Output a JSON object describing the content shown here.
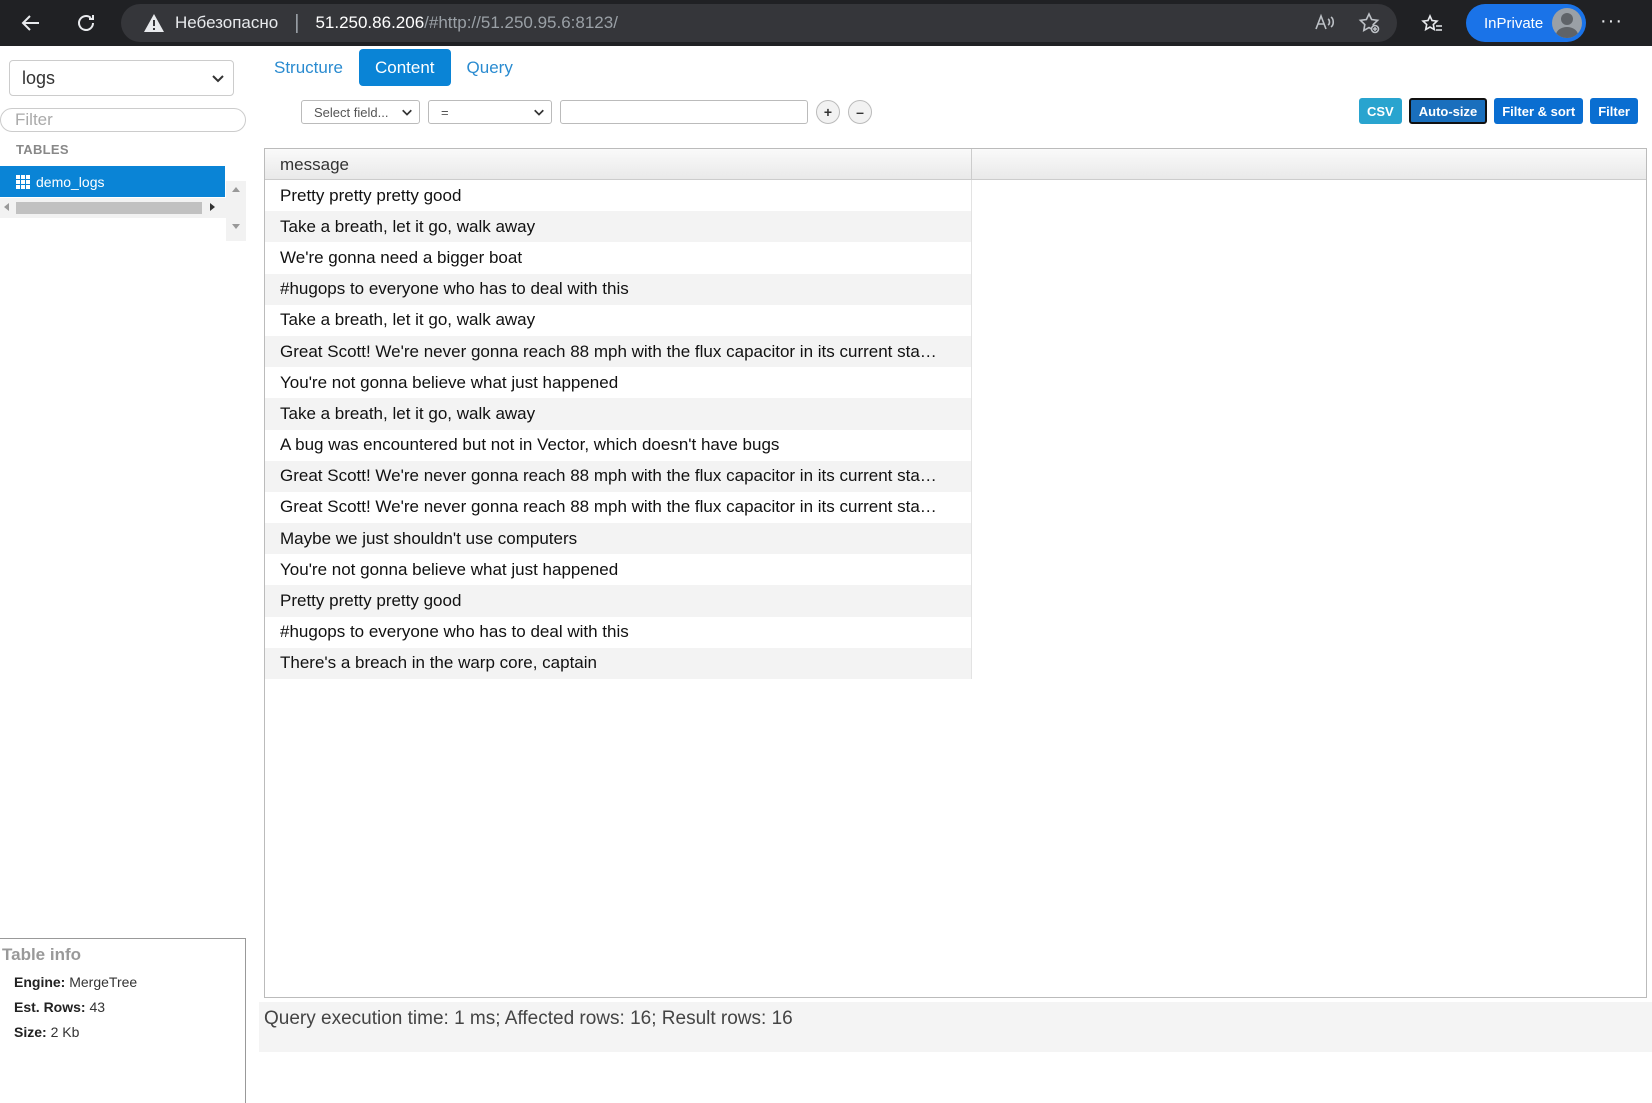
{
  "browser": {
    "insecure_label": "Небезопасно",
    "host": "51.250.86.206",
    "url_rest": "/#http://51.250.95.6:8123/",
    "profile_label": "InPrivate",
    "more_label": "···"
  },
  "sidebar": {
    "database": "logs",
    "filter_placeholder": "Filter",
    "tables_label": "TABLES",
    "tables": [
      {
        "name": "demo_logs"
      }
    ],
    "table_info": {
      "title": "Table info",
      "engine_label": "Engine:",
      "engine": "MergeTree",
      "rows_label": "Est. Rows:",
      "rows": "43",
      "size_label": "Size:",
      "size": "2 Kb"
    }
  },
  "tabs": [
    {
      "label": "Structure",
      "active": false
    },
    {
      "label": "Content",
      "active": true
    },
    {
      "label": "Query",
      "active": false
    }
  ],
  "filter_bar": {
    "field_select": "Select field...",
    "operator_select": "=",
    "value": "",
    "add_label": "+",
    "remove_label": "–"
  },
  "actions": {
    "csv": "CSV",
    "autosize": "Auto-size",
    "filter_sort": "Filter & sort",
    "filter": "Filter"
  },
  "grid": {
    "columns": [
      "message"
    ],
    "rows": [
      "Pretty pretty pretty good",
      "Take a breath, let it go, walk away",
      "We're gonna need a bigger boat",
      "#hugops to everyone who has to deal with this",
      "Take a breath, let it go, walk away",
      "Great Scott! We're never gonna reach 88 mph with the flux capacitor in its current sta…",
      "You're not gonna believe what just happened",
      "Take a breath, let it go, walk away",
      "A bug was encountered but not in Vector, which doesn't have bugs",
      "Great Scott! We're never gonna reach 88 mph with the flux capacitor in its current sta…",
      "Great Scott! We're never gonna reach 88 mph with the flux capacitor in its current sta…",
      "Maybe we just shouldn't use computers",
      "You're not gonna believe what just happened",
      "Pretty pretty pretty good",
      "#hugops to everyone who has to deal with this",
      "There's a breach in the warp core, captain"
    ]
  },
  "status": "Query execution time: 1 ms; Affected rows: 16; Result rows: 16"
}
